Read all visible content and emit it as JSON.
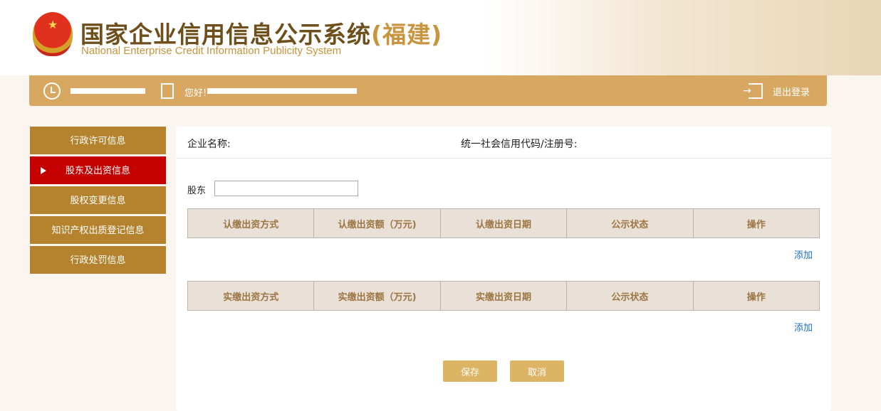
{
  "header": {
    "title_cn": "国家企业信用信息公示系统",
    "province": "(福建)",
    "title_en": "National Enterprise Credit Information Publicity System"
  },
  "topbar": {
    "greeting": "您好!",
    "logout": "退出登录"
  },
  "sidebar": {
    "items": [
      {
        "label": "行政许可信息"
      },
      {
        "label": "股东及出资信息",
        "active": true
      },
      {
        "label": "股权变更信息"
      },
      {
        "label": "知识产权出质登记信息"
      },
      {
        "label": "行政处罚信息"
      }
    ]
  },
  "main": {
    "company_label": "企业名称:",
    "code_label": "统一社会信用代码/注册号:",
    "shareholder_label": "股东",
    "shareholder_value": "",
    "subscribed_table": {
      "headers": [
        "认缴出资方式",
        "认缴出资额（万元)",
        "认缴出资日期",
        "公示状态",
        "操作"
      ],
      "add": "添加"
    },
    "paid_table": {
      "headers": [
        "实缴出资方式",
        "实缴出资额（万元)",
        "实缴出资日期",
        "公示状态",
        "操作"
      ],
      "add": "添加"
    },
    "save": "保存",
    "cancel": "取消"
  }
}
